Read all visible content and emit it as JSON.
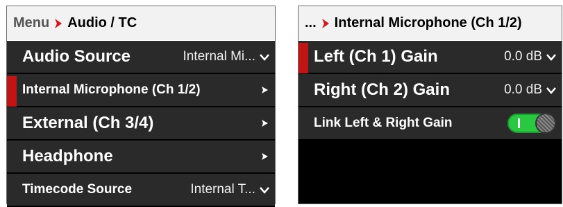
{
  "left_panel": {
    "breadcrumb": {
      "root": "Menu",
      "current": "Audio / TC"
    },
    "items": [
      {
        "label": "Audio Source",
        "value": "Internal Mi...",
        "control": "dropdown"
      },
      {
        "label": "Internal Microphone (Ch 1/2)",
        "control": "submenu",
        "selected": true
      },
      {
        "label": "External (Ch 3/4)",
        "control": "submenu"
      },
      {
        "label": "Headphone",
        "control": "submenu"
      },
      {
        "label": "Timecode Source",
        "value": "Internal T...",
        "control": "dropdown"
      }
    ]
  },
  "right_panel": {
    "breadcrumb": {
      "root": "...",
      "current": "Internal Microphone (Ch 1/2)"
    },
    "items": [
      {
        "label": "Left (Ch 1) Gain",
        "value": "0.0 dB",
        "control": "dropdown",
        "selected": true
      },
      {
        "label": "Right (Ch 2) Gain",
        "value": "0.0 dB",
        "control": "dropdown"
      },
      {
        "label": "Link Left & Right Gain",
        "control": "toggle",
        "state": "on"
      }
    ]
  },
  "colors": {
    "accent": "#e0101a",
    "selection_bar": "#c01515",
    "toggle_on": "#28c840",
    "row_bg": "#2a2a2a",
    "header_bg": "#f2f2f2"
  },
  "icons": {
    "breadcrumb_separator": "red-chevron-right-icon",
    "submenu": "chevron-right-icon",
    "dropdown": "chevron-down-icon"
  }
}
